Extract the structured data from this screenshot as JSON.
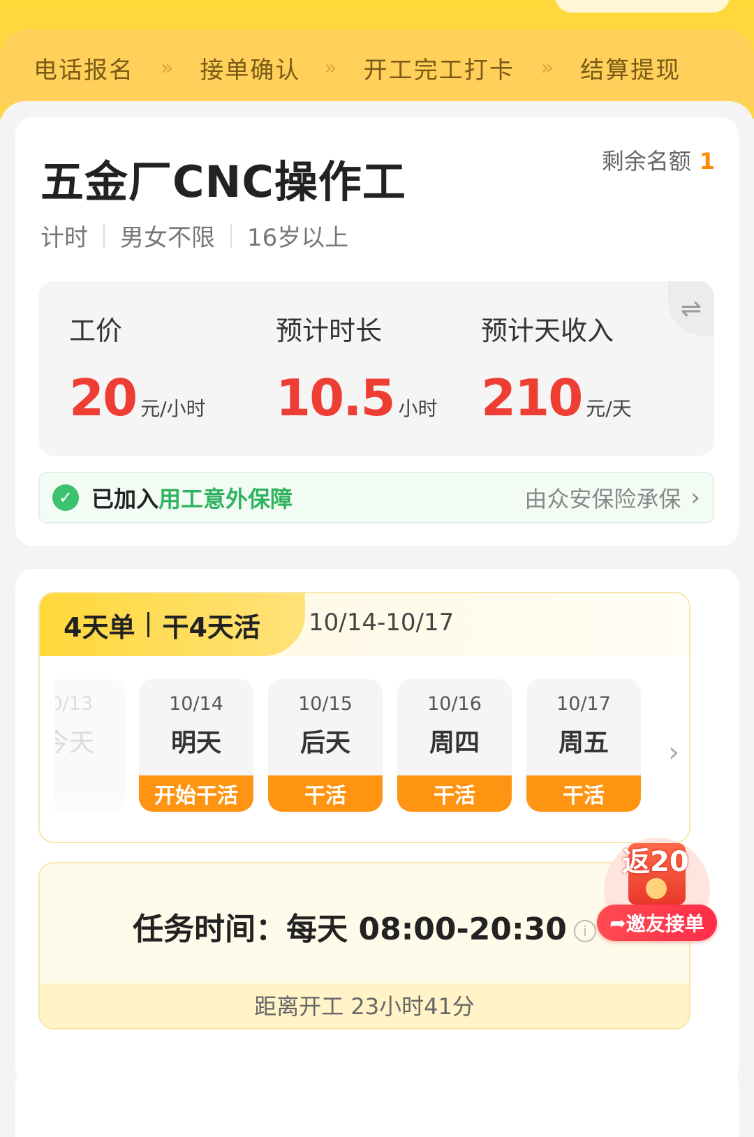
{
  "steps": [
    "电话报名",
    "接单确认",
    "开工完工打卡",
    "结算提现"
  ],
  "step_separator": "»",
  "job": {
    "title": "五金厂CNC操作工",
    "remaining_label": "剩余名额",
    "remaining_count": "1",
    "tags": [
      "计时",
      "男女不限",
      "16岁以上"
    ]
  },
  "pay": {
    "items": [
      {
        "label": "工价",
        "value": "20",
        "unit": "元/小时"
      },
      {
        "label": "预计时长",
        "value": "10.5",
        "unit": "小时"
      },
      {
        "label": "预计天收入",
        "value": "210",
        "unit": "元/天"
      }
    ],
    "swap_icon": "⇌"
  },
  "insurance": {
    "joined": "已加入",
    "plan": "用工意外保障",
    "carrier": "由众安保险承保",
    "chevron": "›"
  },
  "schedule": {
    "order_type": "4天单",
    "work_days": "干4天活",
    "range": "10/14-10/17",
    "days": [
      {
        "date": "0/13",
        "name": "今天",
        "status": ""
      },
      {
        "date": "10/14",
        "name": "明天",
        "status": "开始干活"
      },
      {
        "date": "10/15",
        "name": "后天",
        "status": "干活"
      },
      {
        "date": "10/16",
        "name": "周四",
        "status": "干活"
      },
      {
        "date": "10/17",
        "name": "周五",
        "status": "干活"
      }
    ],
    "next_chevron": "›"
  },
  "task": {
    "time_label": "任务时间：每天 08:00-20:30",
    "countdown": "距离开工 23小时41分"
  },
  "promo": {
    "amount": "返20",
    "button": "邀友接单",
    "icon": "share-arrow-icon"
  },
  "colors": {
    "brand_yellow": "#ffd83a",
    "price_red": "#ee3d32",
    "orange": "#ff9412",
    "green": "#2fb35f"
  }
}
